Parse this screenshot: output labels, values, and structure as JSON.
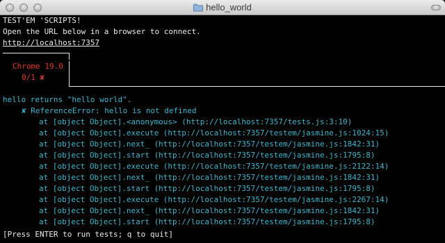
{
  "window": {
    "title": "hello_world",
    "icon": "folder-icon"
  },
  "header": {
    "line1": "TEST'EM 'SCRIPTS!",
    "line2": "Open the URL below in a browser to connect.",
    "url": "http://localhost:7357"
  },
  "browser_box": {
    "name": "Chrome 19.0",
    "status_count": "0/1",
    "status_icon": "✘",
    "colors": {
      "browser": "#e23b2f"
    }
  },
  "test": {
    "description": "hello returns \"hello world\".",
    "error_icon": "✘",
    "error": "ReferenceError: hello is not defined"
  },
  "stack": [
    "at [object Object].<anonymous> (http://localhost:7357/tests.js:3:10)",
    "at [object Object].execute (http://localhost:7357/testem/jasmine.js:1024:15)",
    "at [object Object].next_ (http://localhost:7357/testem/jasmine.js:1842:31)",
    "at [object Object].start (http://localhost:7357/testem/jasmine.js:1795:8)",
    "at [object Object].execute (http://localhost:7357/testem/jasmine.js:2122:14)",
    "at [object Object].next_ (http://localhost:7357/testem/jasmine.js:1842:31)",
    "at [object Object].start (http://localhost:7357/testem/jasmine.js:1795:8)",
    "at [object Object].execute (http://localhost:7357/testem/jasmine.js:2267:14)",
    "at [object Object].next_ (http://localhost:7357/testem/jasmine.js:1842:31)",
    "at [object Object].start (http://localhost:7357/testem/jasmine.js:1795:8)"
  ],
  "footer": {
    "prompt": "[Press ENTER to run tests; q to quit]"
  },
  "colors": {
    "error": "#3fb8d0",
    "fail": "#e23b2f",
    "text": "#e8e8e8",
    "background": "#000000"
  }
}
